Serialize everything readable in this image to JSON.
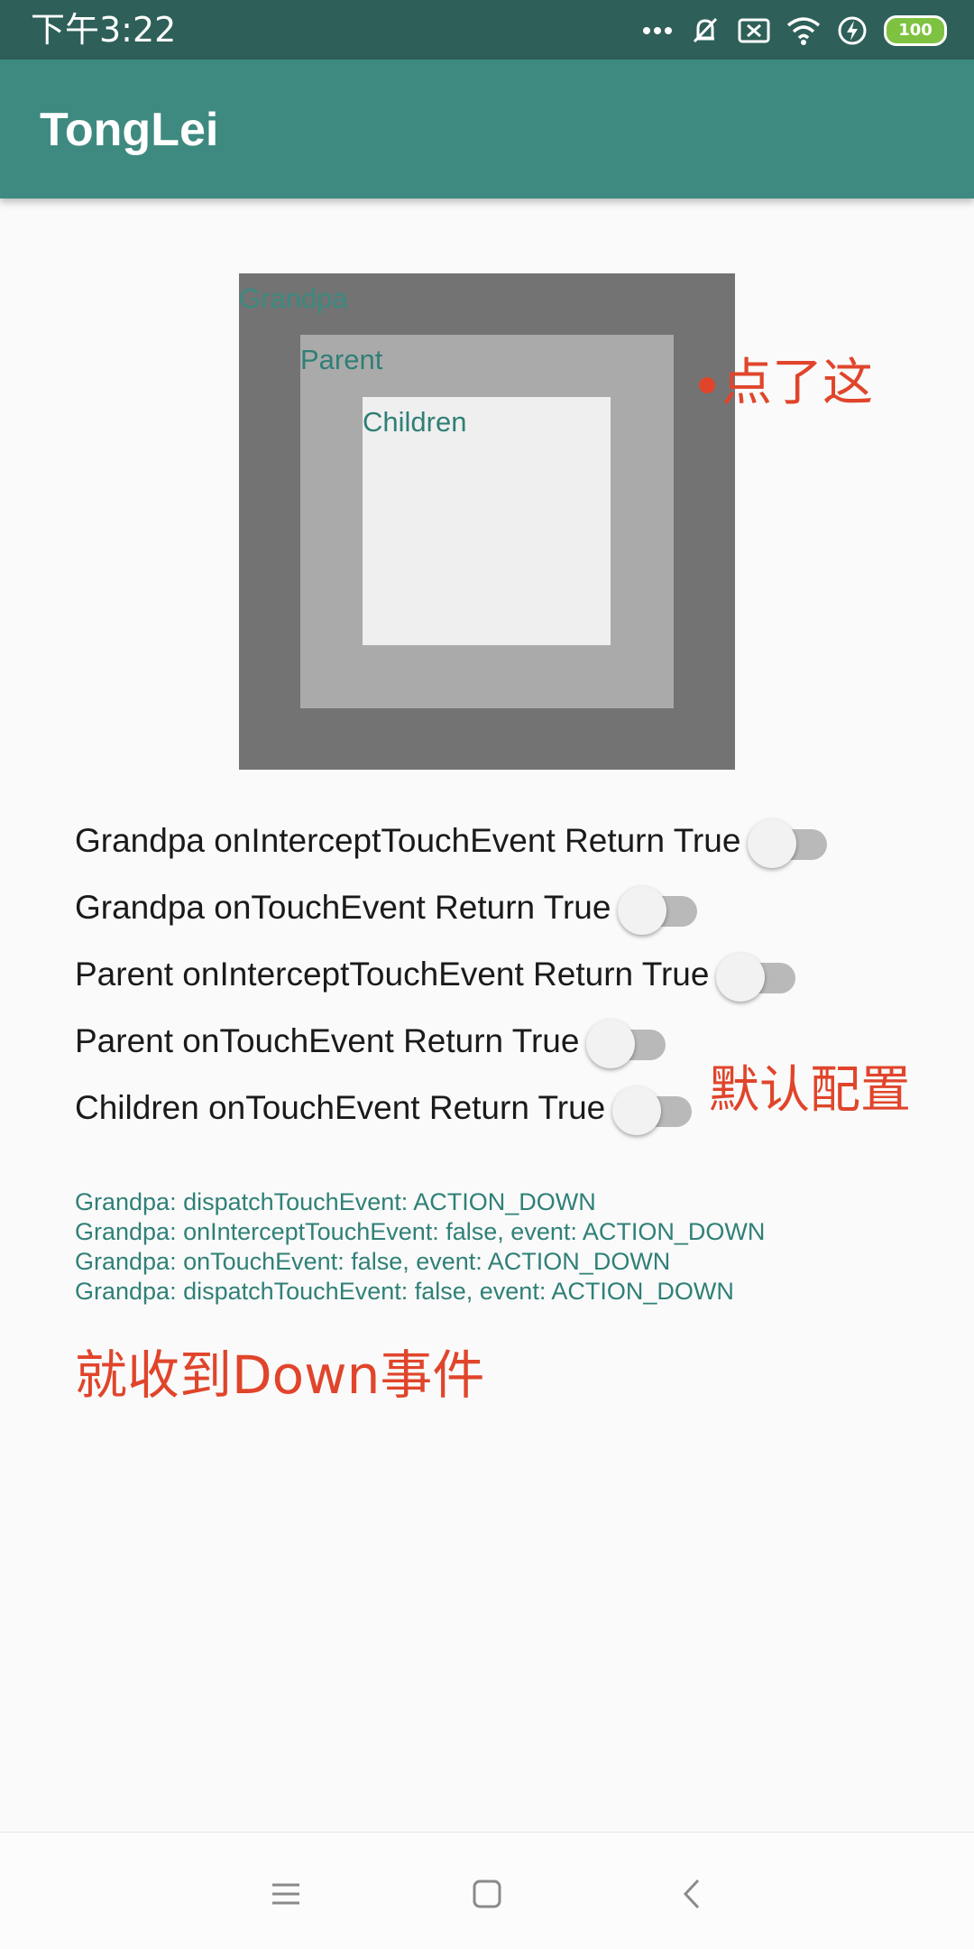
{
  "status_bar": {
    "time": "下午3:22",
    "battery": "100",
    "icons": [
      "more-dots-icon",
      "silent-icon",
      "sim-off-icon",
      "wifi-icon",
      "charging-icon",
      "battery-icon"
    ]
  },
  "app_bar": {
    "title": "TongLei"
  },
  "views": {
    "grandpa_label": "Grandpa",
    "parent_label": "Parent",
    "children_label": "Children"
  },
  "switches": [
    {
      "label": "Grandpa onInterceptTouchEvent Return True",
      "checked": false
    },
    {
      "label": "Grandpa onTouchEvent Return True",
      "checked": false
    },
    {
      "label": "Parent onInterceptTouchEvent Return True",
      "checked": false
    },
    {
      "label": "Parent onTouchEvent Return True",
      "checked": false
    },
    {
      "label": "Children onTouchEvent Return True",
      "checked": false
    }
  ],
  "log": [
    "Grandpa: dispatchTouchEvent: ACTION_DOWN",
    "Grandpa: onInterceptTouchEvent: false, event: ACTION_DOWN",
    "Grandpa: onTouchEvent: false, event: ACTION_DOWN",
    "Grandpa: dispatchTouchEvent: false, event: ACTION_DOWN"
  ],
  "annotations": {
    "clicked_here": "点了这",
    "default_config": "默认配置",
    "only_down": "就收到Down事件",
    "color": "#e0452b"
  },
  "colors": {
    "status_bar": "#2e5f58",
    "app_bar": "#3e8a80",
    "grandpa": "#737373",
    "parent": "#aaaaaa",
    "children": "#efefef",
    "log_text": "#2f8077"
  },
  "nav_bar": {
    "icons": [
      "menu-icon",
      "home-icon",
      "back-icon"
    ]
  }
}
